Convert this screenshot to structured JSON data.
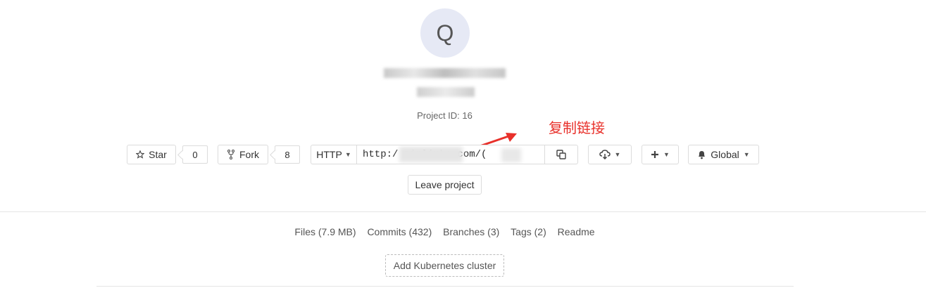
{
  "project": {
    "avatar_letter": "Q",
    "id_text": "Project ID: 16"
  },
  "annotation": {
    "text": "复制链接",
    "color": "#e8302a"
  },
  "actions": {
    "star_label": "Star",
    "star_count": "0",
    "fork_label": "Fork",
    "fork_count": "8",
    "clone_protocol": "HTTP",
    "clone_url": "http:/ zinlinke com/(",
    "notification_label": "Global",
    "leave_label": "Leave project"
  },
  "stats": {
    "files": "Files (7.9 MB)",
    "commits": "Commits (432)",
    "branches": "Branches (3)",
    "tags": "Tags (2)",
    "readme": "Readme"
  },
  "kubernetes_button": "Add Kubernetes cluster"
}
